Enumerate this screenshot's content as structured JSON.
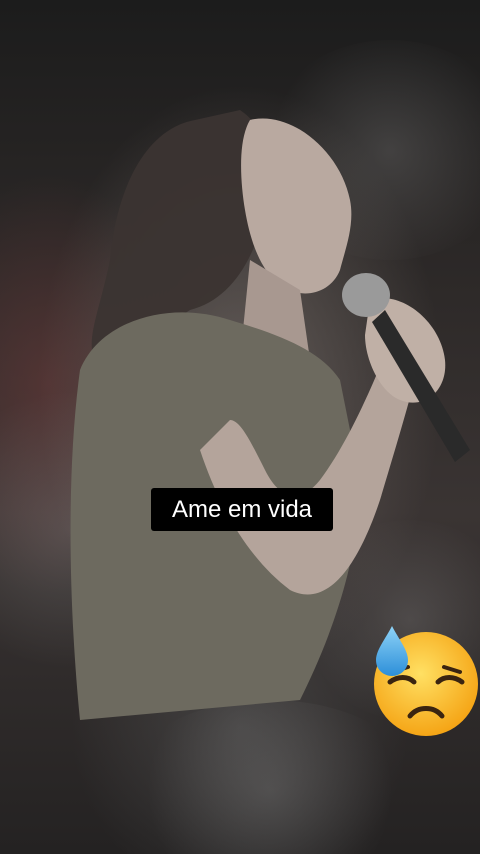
{
  "caption": {
    "text": "Ame em vida"
  },
  "sticker": {
    "icon": "sad-sweat-face-icon",
    "color_face": "#F9B91E"
  }
}
